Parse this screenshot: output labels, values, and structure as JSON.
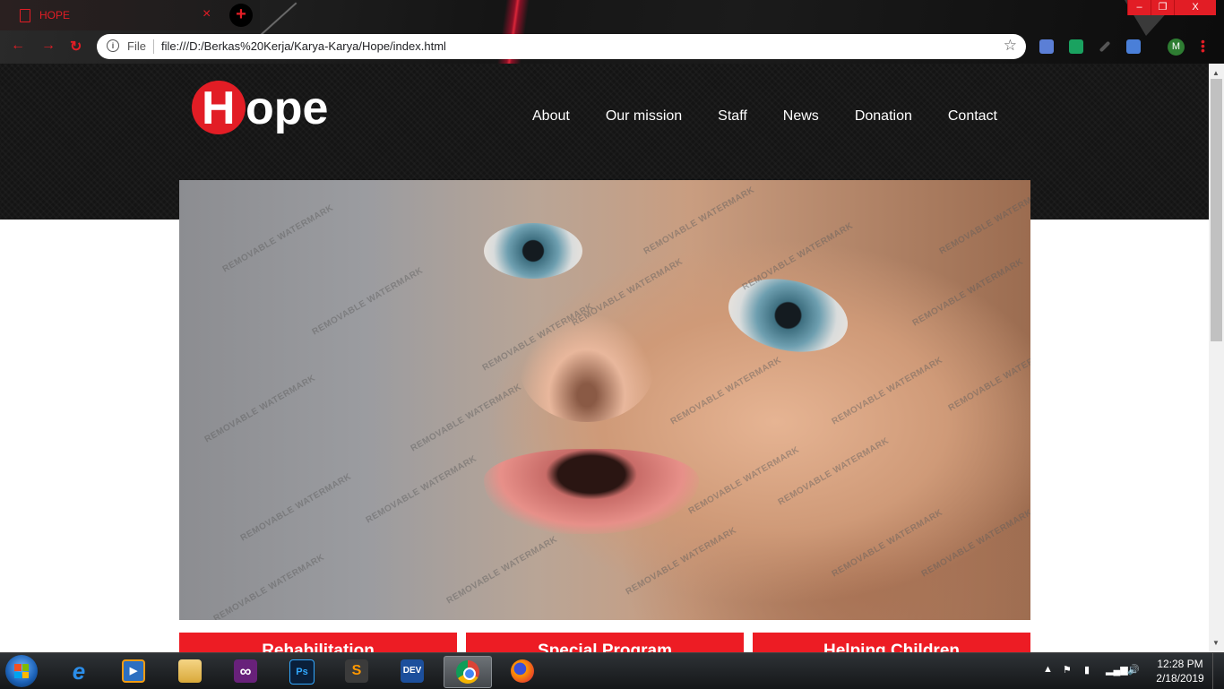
{
  "browser": {
    "tab_title": "HOPE",
    "tab_close": "×",
    "new_tab": "+",
    "url_scheme_label": "File",
    "url": "file:///D:/Berkas%20Kerja/Karya-Karya/Hope/index.html",
    "avatar_initial": "M",
    "window_buttons": [
      "–",
      "❐",
      "X"
    ],
    "nav_back": "←",
    "nav_forward": "→",
    "nav_reload": "↻",
    "star": "☆",
    "accent_color": "#e21d25"
  },
  "site": {
    "logo_initial": "H",
    "logo_rest": "ope",
    "nav": [
      "About",
      "Our mission",
      "Staff",
      "News",
      "Donation",
      "Contact"
    ],
    "hero_watermark": "REMOVABLE WATERMARK",
    "tiles": [
      "Rehabilitation",
      "Special Program",
      "Helping Children"
    ],
    "brand_red": "#ed1c24",
    "header_bg": "#141414"
  },
  "taskbar": {
    "apps": [
      {
        "name": "internet-explorer",
        "label": "e"
      },
      {
        "name": "media-player",
        "label": "▶"
      },
      {
        "name": "file-explorer",
        "label": ""
      },
      {
        "name": "visual-studio",
        "label": "∞"
      },
      {
        "name": "photoshop",
        "label": "Ps"
      },
      {
        "name": "sublime-text",
        "label": "S"
      },
      {
        "name": "dev-cpp",
        "label": "DEV"
      },
      {
        "name": "chrome",
        "label": ""
      },
      {
        "name": "firefox",
        "label": ""
      }
    ],
    "time": "12:28 PM",
    "date": "2/18/2019"
  }
}
